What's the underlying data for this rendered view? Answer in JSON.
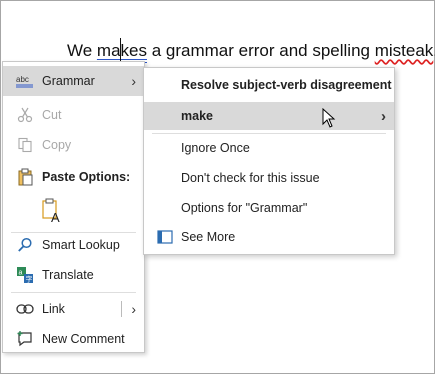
{
  "document": {
    "text_before": "We ",
    "grammar_error": "makes",
    "text_middle": " a grammar error and spelling ",
    "spelling_error": "misteak",
    "text_after": "."
  },
  "context_menu": {
    "items": [
      {
        "label": "Grammar",
        "icon": "abc-icon",
        "submenu": true,
        "state": "highlighted"
      },
      {
        "label": "Cut",
        "icon": "scissors-icon",
        "state": "disabled"
      },
      {
        "label": "Copy",
        "icon": "copy-icon",
        "state": "disabled"
      },
      {
        "label": "Paste Options:",
        "icon": "clipboard-icon",
        "state": "header"
      },
      {
        "label": "",
        "icon": "paste-text-only-icon",
        "state": "normal"
      },
      {
        "label": "Smart Lookup",
        "icon": "search-icon",
        "state": "normal"
      },
      {
        "label": "Translate",
        "icon": "translate-icon",
        "state": "normal"
      },
      {
        "label": "Link",
        "icon": "link-icon",
        "submenu": true,
        "state": "normal"
      },
      {
        "label": "New Comment",
        "icon": "comment-icon",
        "state": "normal"
      }
    ]
  },
  "grammar_submenu": {
    "title": "Resolve subject-verb disagreement",
    "suggestion": "make",
    "options": [
      "Ignore Once",
      "Don't check for this issue",
      "Options for \"Grammar\"",
      "See More"
    ]
  },
  "colors": {
    "highlight": "#d9d9d9",
    "grammar_underline": "#2f57c8",
    "spelling_underline": "#dd2222"
  }
}
